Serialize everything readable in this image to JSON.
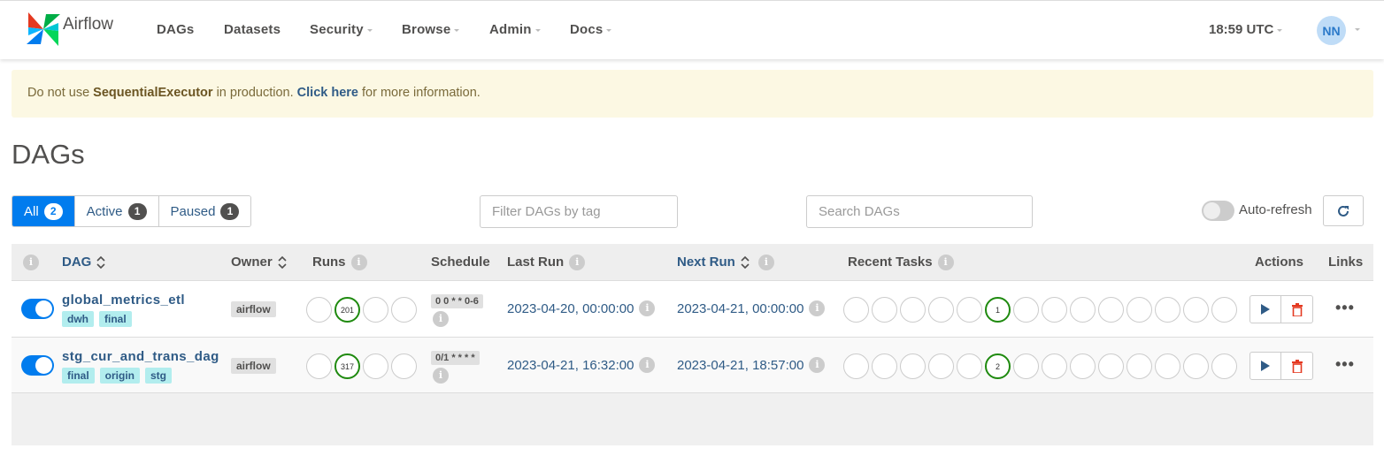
{
  "navbar": {
    "brand": "Airflow",
    "items": [
      {
        "label": "DAGs",
        "dropdown": false
      },
      {
        "label": "Datasets",
        "dropdown": false
      },
      {
        "label": "Security",
        "dropdown": true
      },
      {
        "label": "Browse",
        "dropdown": true
      },
      {
        "label": "Admin",
        "dropdown": true
      },
      {
        "label": "Docs",
        "dropdown": true
      }
    ],
    "clock": "18:59 UTC",
    "user_initials": "NN"
  },
  "alert": {
    "prefix": "Do not use ",
    "executor": "SequentialExecutor",
    "middle": " in production. ",
    "link": "Click here",
    "suffix": " for more information."
  },
  "page_title": "DAGs",
  "filters": {
    "all_label": "All",
    "all_count": "2",
    "active_label": "Active",
    "active_count": "1",
    "paused_label": "Paused",
    "paused_count": "1",
    "tag_placeholder": "Filter DAGs by tag",
    "search_placeholder": "Search DAGs",
    "auto_refresh_label": "Auto-refresh",
    "auto_refresh_on": false
  },
  "table": {
    "headers": {
      "info": "i",
      "dag": "DAG",
      "owner": "Owner",
      "runs": "Runs",
      "schedule": "Schedule",
      "last_run": "Last Run",
      "next_run": "Next Run",
      "recent_tasks": "Recent Tasks",
      "actions": "Actions",
      "links": "Links"
    },
    "rows": [
      {
        "dag_id": "global_metrics_etl",
        "tags": [
          "dwh",
          "final"
        ],
        "owner": "airflow",
        "runs_success": "201",
        "schedule": "0 0 * * 0-6",
        "last_run": "2023-04-20, 00:00:00",
        "next_run": "2023-04-21, 00:00:00",
        "tasks_success": "1",
        "active": true
      },
      {
        "dag_id": "stg_cur_and_trans_dag",
        "tags": [
          "final",
          "origin",
          "stg"
        ],
        "owner": "airflow",
        "runs_success": "317",
        "schedule": "0/1 * * * *",
        "last_run": "2023-04-21, 16:32:00",
        "next_run": "2023-04-21, 18:57:00",
        "tasks_success": "2",
        "active": true
      }
    ],
    "more_label": "•••"
  },
  "colors": {
    "primary": "#017cee",
    "link": "#2f5b86",
    "success": "#1f8a0f",
    "delete": "#e43921",
    "alert_bg": "#fcf8e3"
  }
}
